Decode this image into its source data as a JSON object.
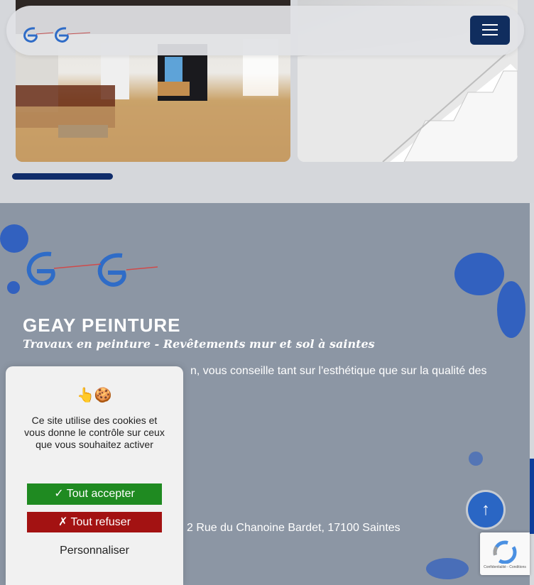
{
  "header": {
    "logo_alt": "Geay Peinture",
    "menu_icon": "hamburger-icon"
  },
  "footer": {
    "company_name": "GEAY PEINTURE",
    "tagline": "Travaux en peinture - Revêtements mur et sol à saintes",
    "description": "n, vous conseille tant sur l'esthétique que sur la qualité des",
    "address": "2 Rue du Chanoine Bardet, 17100 Saintes"
  },
  "cookie_banner": {
    "icons": "👆🍪",
    "message": "Ce site utilise des cookies et vous donne le contrôle sur ceux que vous souhaitez activer",
    "accept_label": "✓ Tout accepter",
    "refuse_label": "✗ Tout refuser",
    "customize_label": "Personnaliser"
  },
  "scroll_top": {
    "icon": "arrow-up-icon",
    "glyph": "↑"
  },
  "recaptcha": {
    "text": "Confidentialité - Conditions"
  },
  "colors": {
    "navy": "#102d5e",
    "accept": "#1f8a21",
    "refuse": "#a31212",
    "footer_bg": "#8c96a4"
  }
}
